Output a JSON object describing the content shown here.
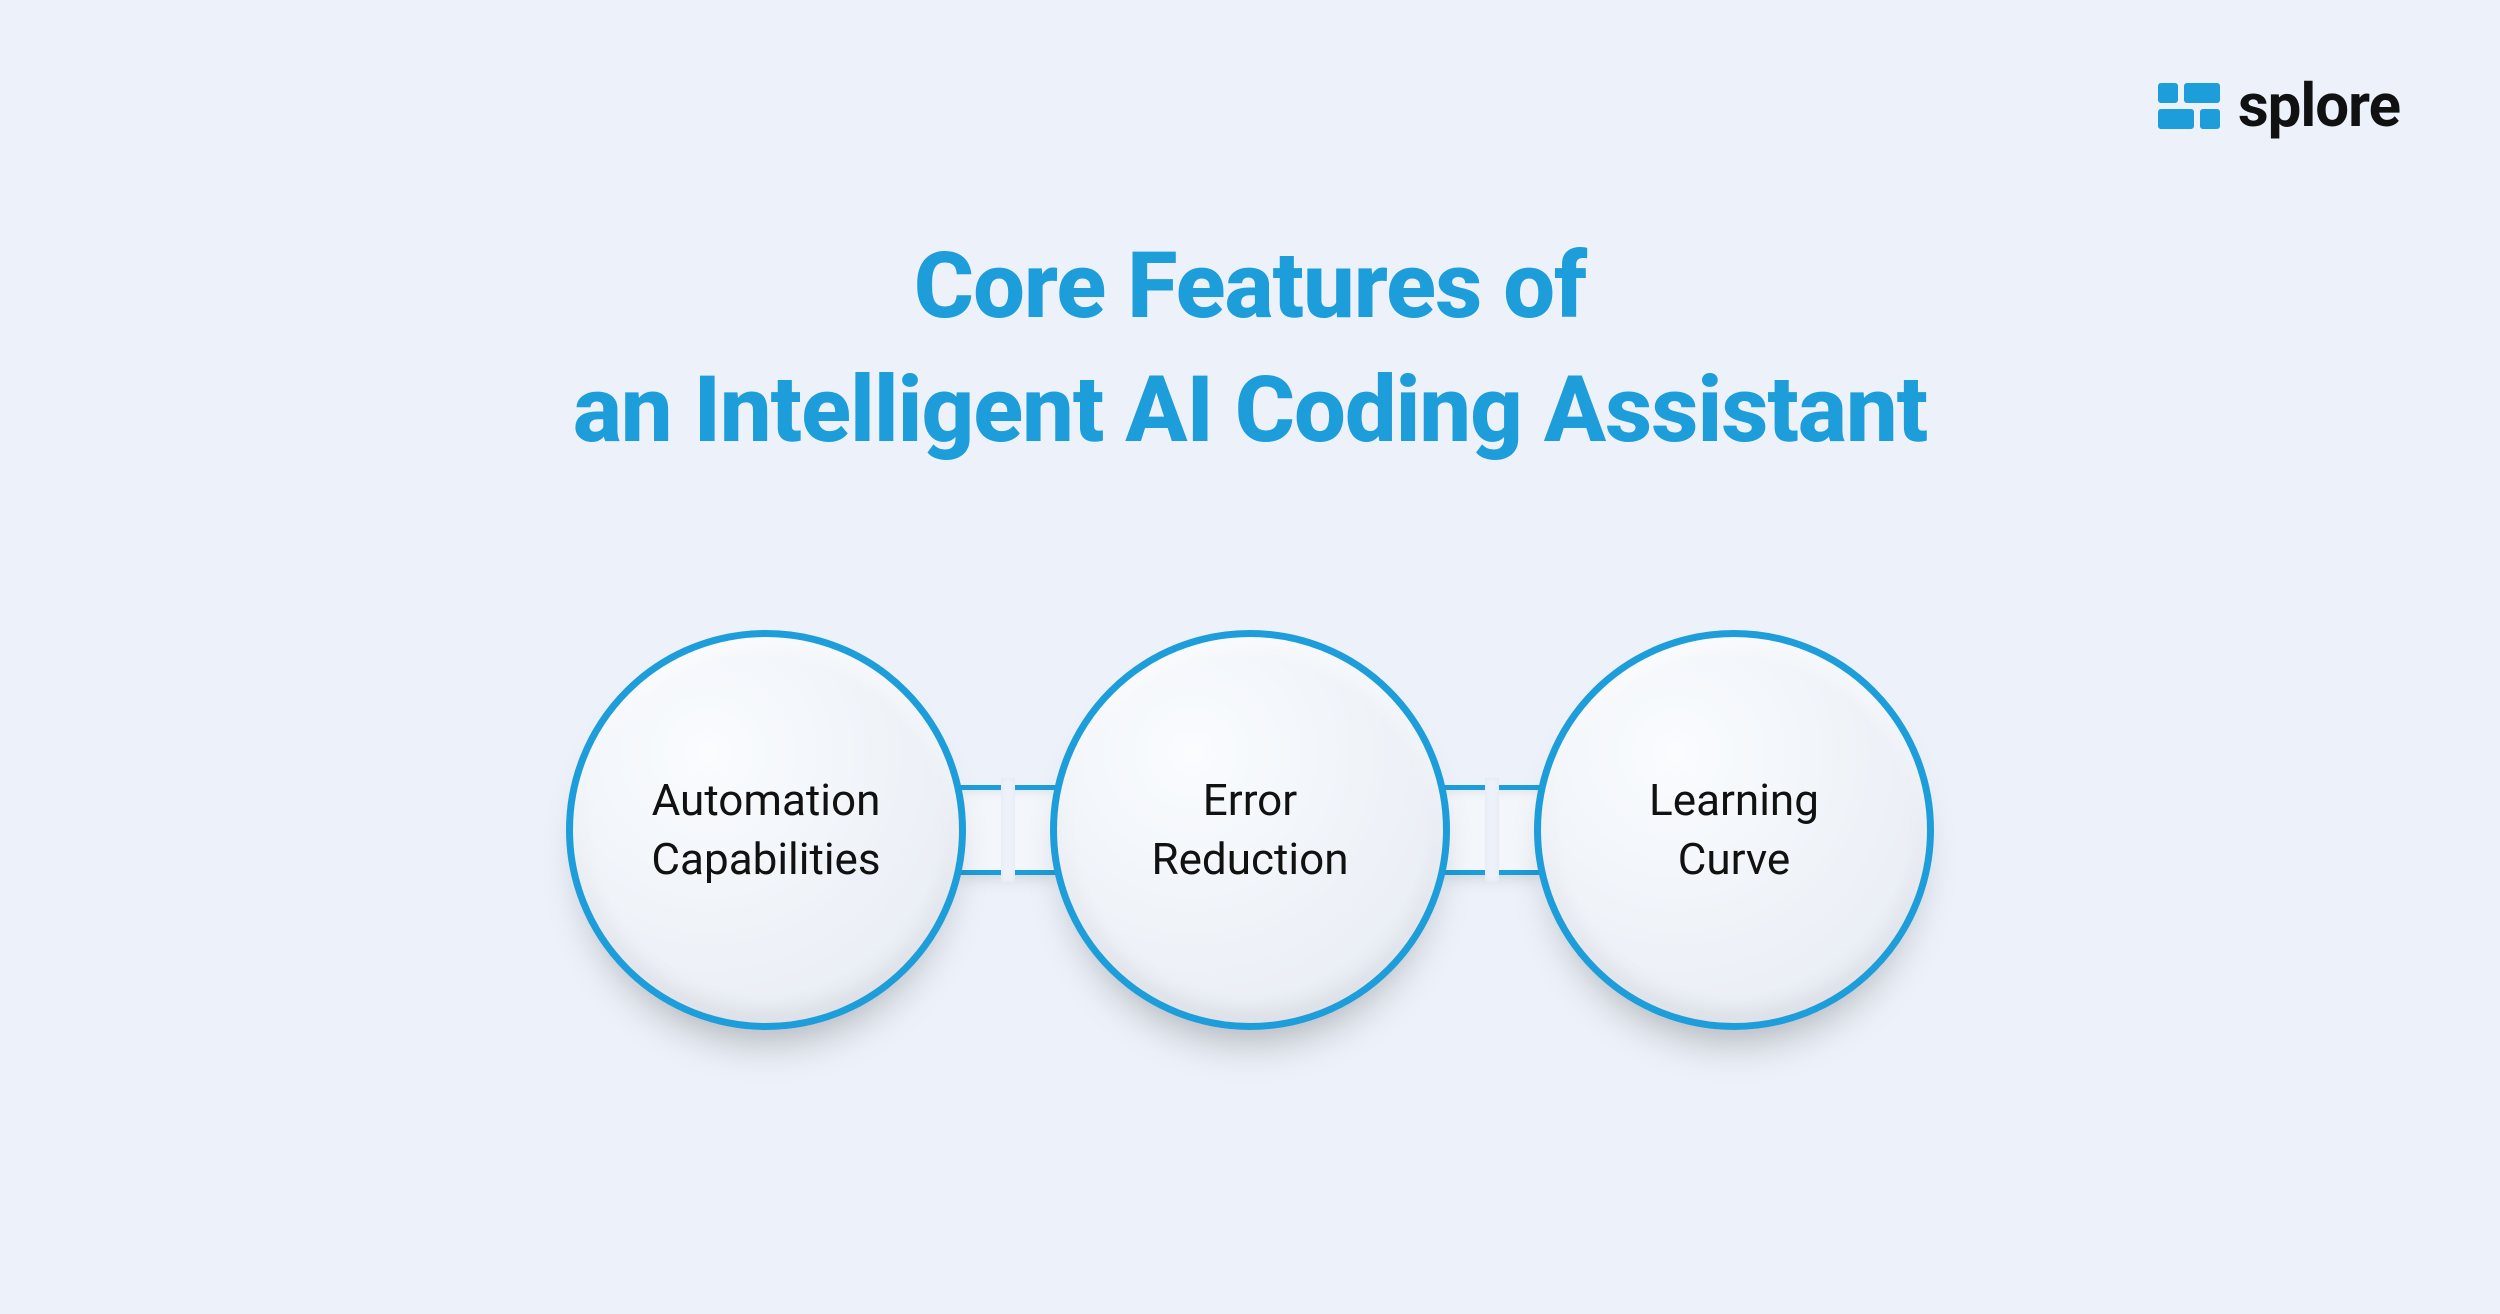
{
  "brand": {
    "name": "splore"
  },
  "title_line1": "Core Features of",
  "title_line2": "an Intelligent AI Coding Assistant",
  "features": [
    {
      "line1": "Automation",
      "line2": "Capabilities"
    },
    {
      "line1": "Error",
      "line2": "Reduction"
    },
    {
      "line1": "Learning",
      "line2": "Curve"
    }
  ],
  "colors": {
    "accent": "#1d9dd9",
    "background": "#edf2fa"
  }
}
